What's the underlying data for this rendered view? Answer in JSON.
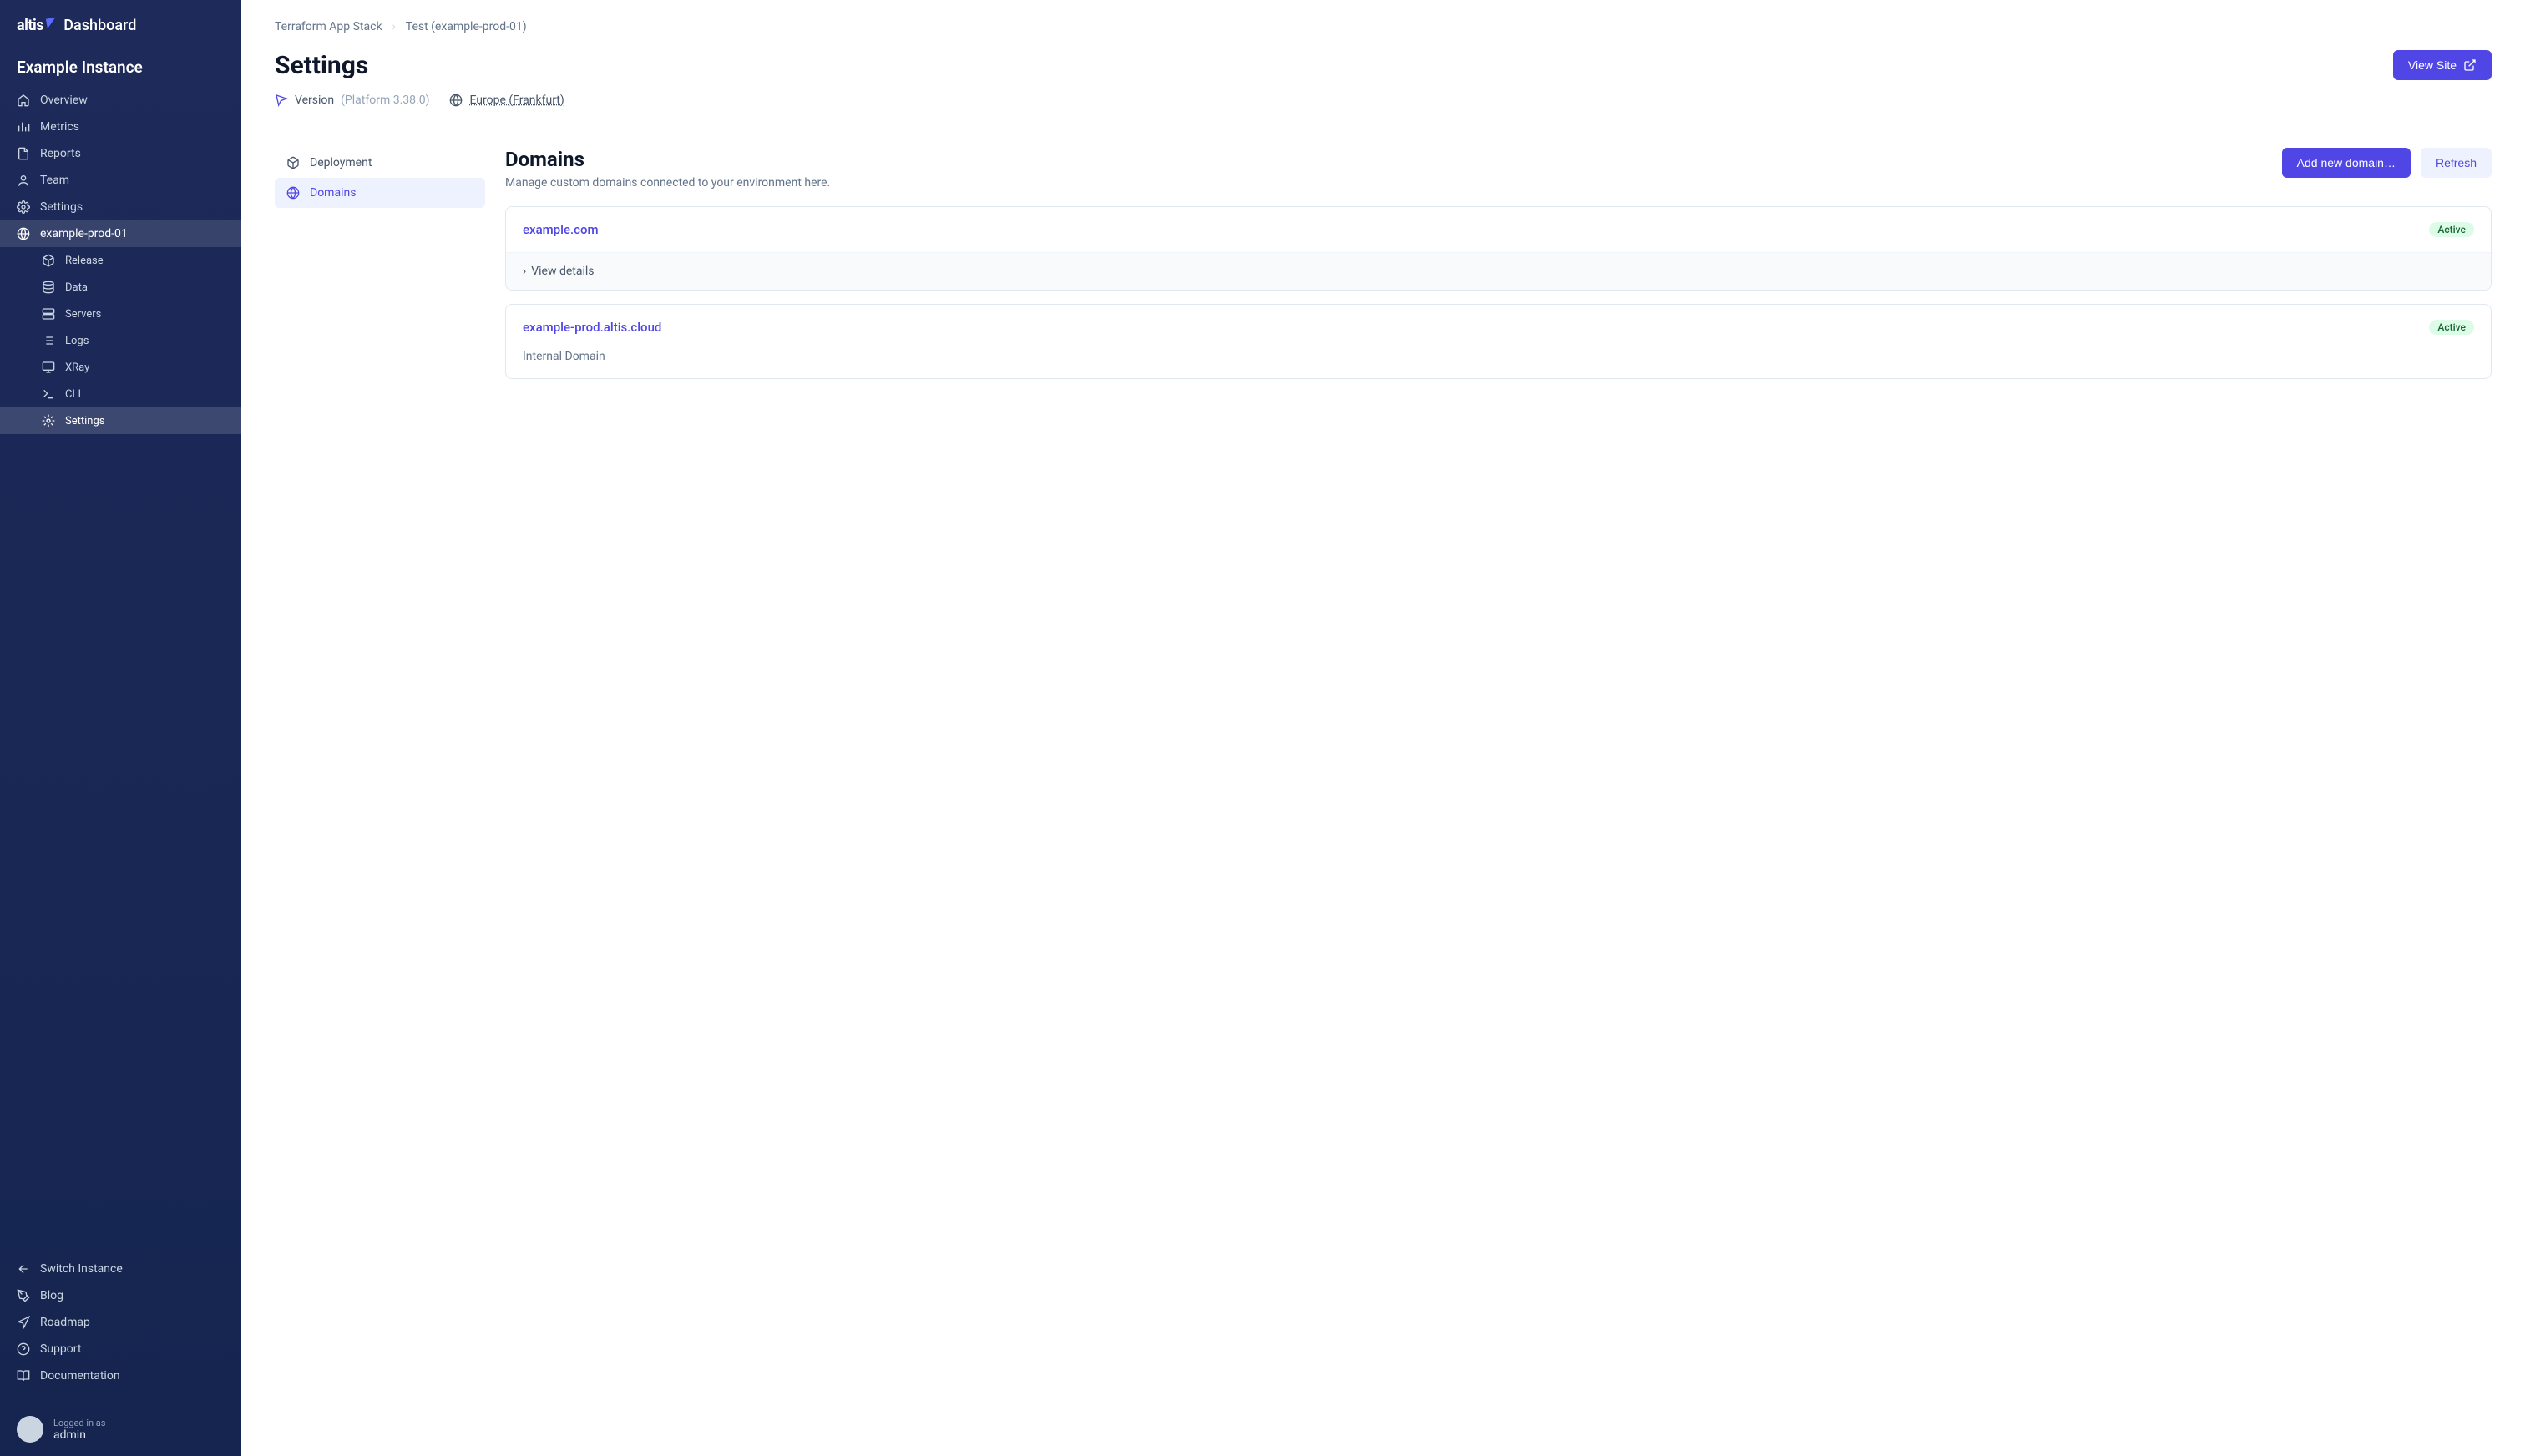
{
  "brand": {
    "name": "altis",
    "product": "Dashboard"
  },
  "instance": {
    "name": "Example Instance"
  },
  "sidebar": {
    "items": [
      {
        "label": "Overview"
      },
      {
        "label": "Metrics"
      },
      {
        "label": "Reports"
      },
      {
        "label": "Team"
      },
      {
        "label": "Settings"
      },
      {
        "label": "example-prod-01"
      }
    ],
    "subitems": [
      {
        "label": "Release"
      },
      {
        "label": "Data"
      },
      {
        "label": "Servers"
      },
      {
        "label": "Logs"
      },
      {
        "label": "XRay"
      },
      {
        "label": "CLI"
      },
      {
        "label": "Settings"
      }
    ],
    "footer": [
      {
        "label": "Switch Instance"
      },
      {
        "label": "Blog"
      },
      {
        "label": "Roadmap"
      },
      {
        "label": "Support"
      },
      {
        "label": "Documentation"
      }
    ]
  },
  "user": {
    "meta": "Logged in as",
    "name": "admin"
  },
  "breadcrumb": {
    "items": [
      "Terraform App Stack",
      "Test (example-prod-01)"
    ]
  },
  "page": {
    "title": "Settings",
    "view_site": "View Site",
    "version_label": "Version",
    "version_value": "(Platform 3.38.0)",
    "region": "Europe (Frankfurt)"
  },
  "tabs": [
    {
      "label": "Deployment"
    },
    {
      "label": "Domains"
    }
  ],
  "panel": {
    "title": "Domains",
    "subtitle": "Manage custom domains connected to your environment here.",
    "add_button": "Add new domain…",
    "refresh_button": "Refresh"
  },
  "domains": [
    {
      "name": "example.com",
      "status": "Active",
      "toggle": "View details"
    },
    {
      "name": "example-prod.altis.cloud",
      "status": "Active",
      "subtitle": "Internal Domain"
    }
  ]
}
